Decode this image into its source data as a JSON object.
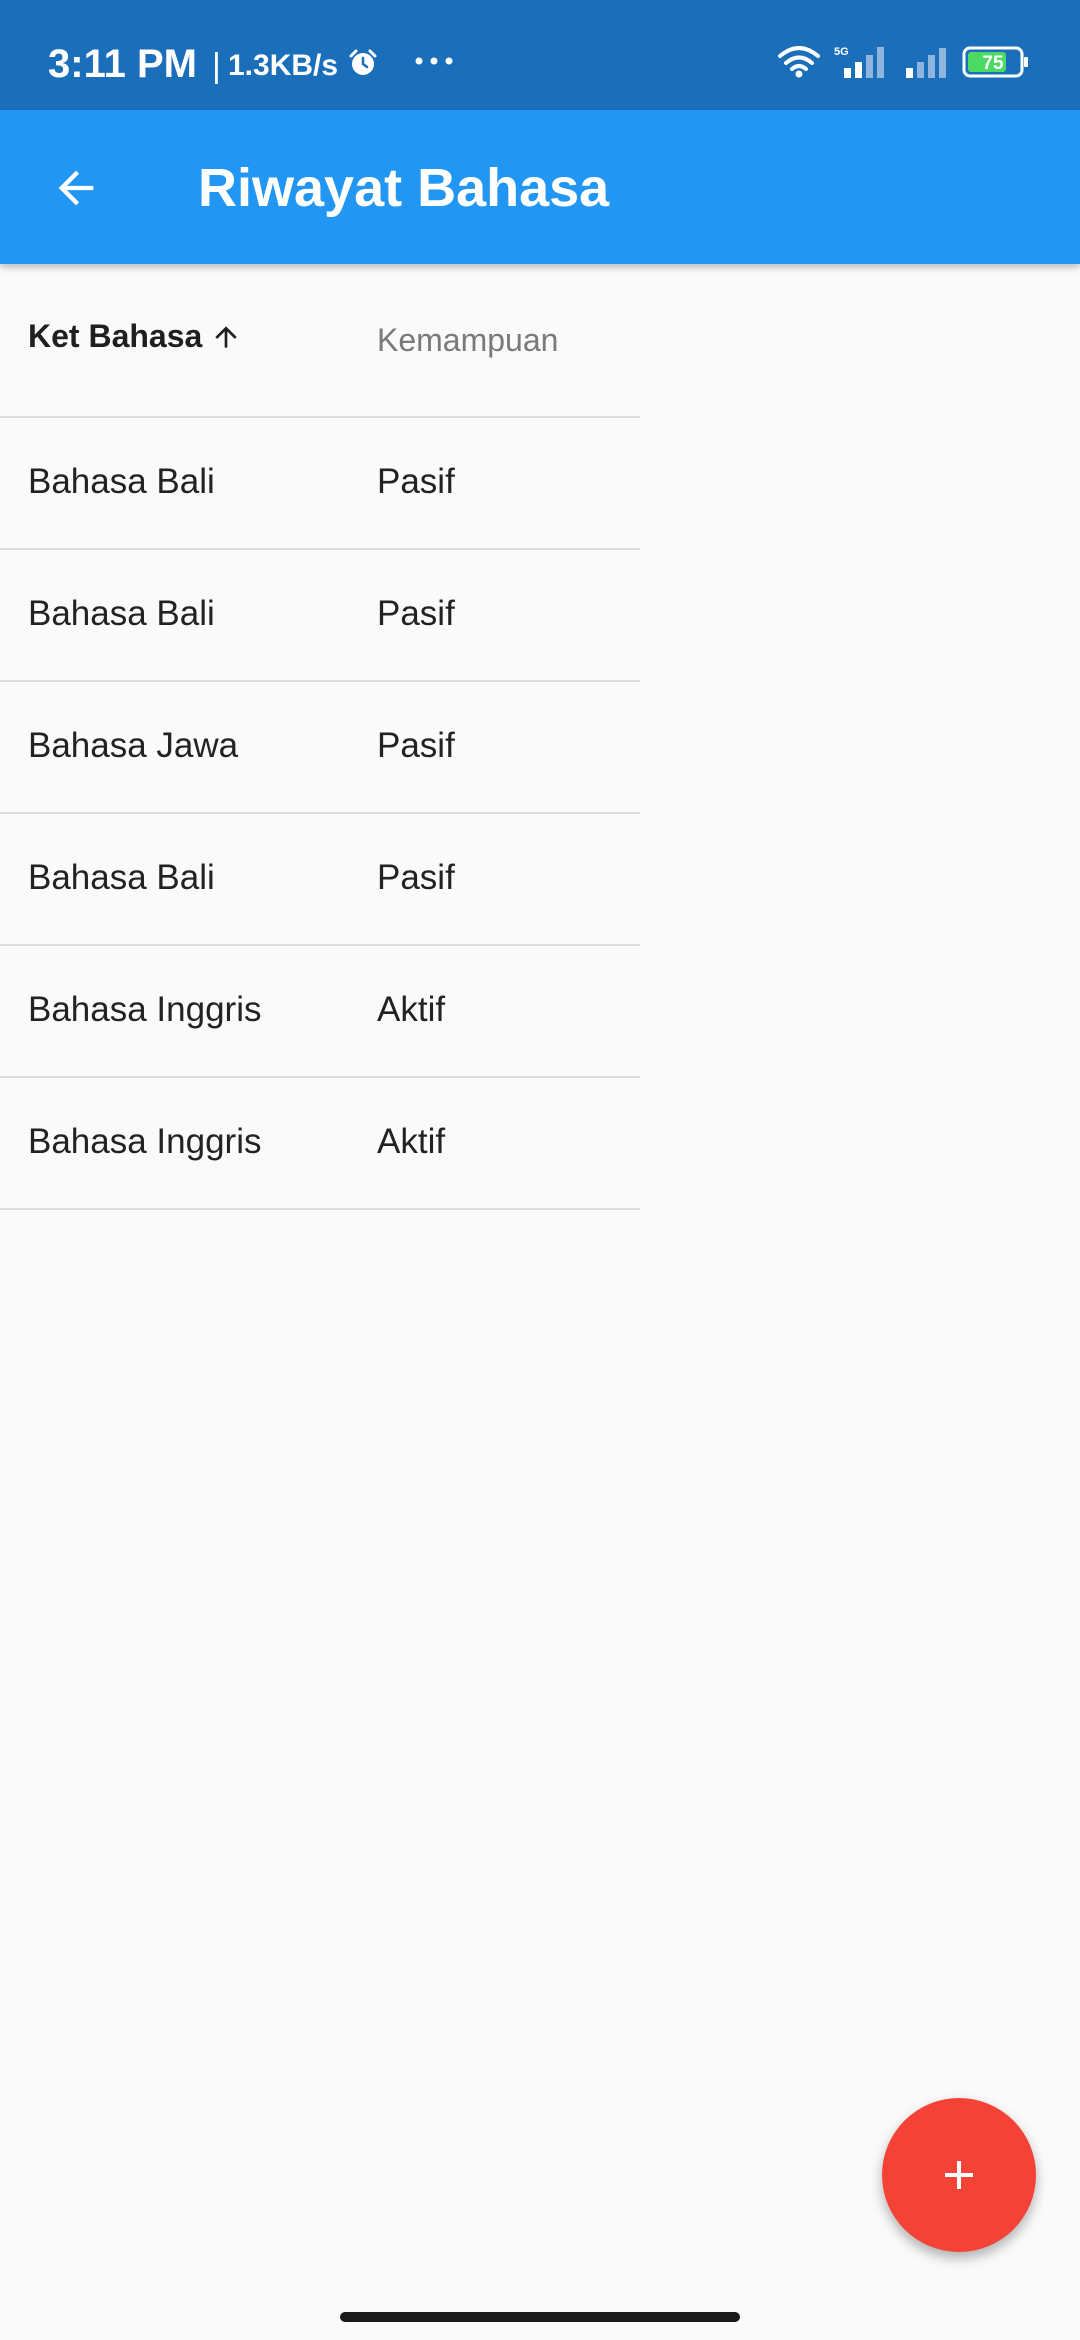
{
  "status_bar": {
    "time": "3:11 PM",
    "separator": "|",
    "network_speed": "1.3KB/s",
    "battery_level": "75",
    "network_type": "5G",
    "icons": [
      "alarm-icon",
      "more-dots-icon",
      "wifi-icon",
      "signal-icon",
      "battery-icon"
    ]
  },
  "app_bar": {
    "title": "Riwayat Bahasa",
    "back_icon": "arrow-back-icon",
    "background_color": "#2196f3"
  },
  "table": {
    "columns": [
      {
        "label": "Ket Bahasa",
        "sorted": "ascending",
        "sort_icon": "arrow-up-icon"
      },
      {
        "label": "Kemampuan"
      }
    ],
    "rows": [
      {
        "bahasa": "Bahasa Bali",
        "kemampuan": "Pasif"
      },
      {
        "bahasa": "Bahasa Bali",
        "kemampuan": "Pasif"
      },
      {
        "bahasa": "Bahasa Jawa",
        "kemampuan": "Pasif"
      },
      {
        "bahasa": "Bahasa Bali",
        "kemampuan": "Pasif"
      },
      {
        "bahasa": "Bahasa Inggris",
        "kemampuan": "Aktif"
      },
      {
        "bahasa": "Bahasa Inggris",
        "kemampuan": "Aktif"
      }
    ]
  },
  "fab": {
    "icon": "plus-icon",
    "color": "#f44336"
  },
  "colors": {
    "status_bar": "#1b6fba",
    "battery_fill": "#4cd964"
  }
}
